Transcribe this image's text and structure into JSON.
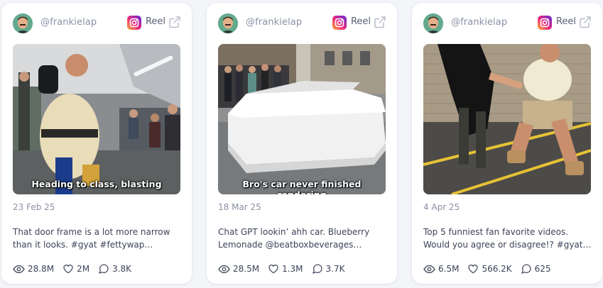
{
  "cards": [
    {
      "handle": "@frankielap",
      "platform_label": "Reel",
      "platform_icon": "instagram-icon",
      "video_caption": "Heading to class, blasting",
      "date": "23 Feb 25",
      "description": "That door frame is a lot more narrow than it looks. #gyat #fettywap #meme…",
      "views": "28.8M",
      "likes": "2M",
      "comments": "3.8K"
    },
    {
      "handle": "@frankielap",
      "platform_label": "Reel",
      "platform_icon": "instagram-icon",
      "video_caption": "Bro's car never finished rendering",
      "date": "18 Mar 25",
      "description": "Chat GPT lookin’ ahh car. Blueberry Lemonade @beatboxbeverages…",
      "views": "28.5M",
      "likes": "1.3M",
      "comments": "3.7K"
    },
    {
      "handle": "@frankielap",
      "platform_label": "Reel",
      "platform_icon": "instagram-icon",
      "date": "4 Apr 25",
      "description": "Top 5 funniest fan favorite videos. Would you agree or disagree!? #gyat…",
      "views": "6.5M",
      "likes": "566.2K",
      "comments": "625"
    }
  ],
  "colors": {
    "muted_text": "#8b91a6",
    "body_text": "#3d4358",
    "card_bg": "#ffffff",
    "page_bg": "#f4f5f9"
  }
}
